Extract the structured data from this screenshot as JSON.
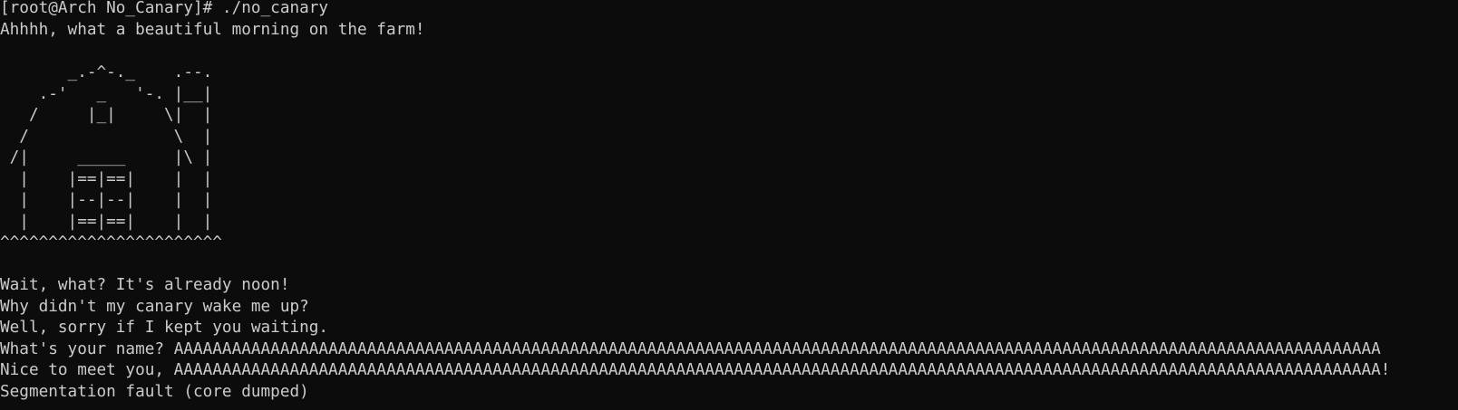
{
  "terminal": {
    "prompt": "[root@Arch No_Canary]# ",
    "command": "./no_canary",
    "greeting": "Ahhhh, what a beautiful morning on the farm!",
    "ascii_art": [
      "       _.-^-._    .--.",
      "    .-'   _   '-. |__|",
      "   /     |_|     \\|  |",
      "  /               \\  |",
      " /|     _____     |\\ |",
      "  |    |==|==|    |  |",
      "  |    |--|--|    |  |",
      "  |    |==|==|    |  |",
      "^^^^^^^^^^^^^^^^^^^^^^^"
    ],
    "messages": [
      "Wait, what? It's already noon!",
      "Why didn't my canary wake me up?",
      "Well, sorry if I kept you waiting."
    ],
    "name_prompt": "What's your name? ",
    "name_input": "AAAAAAAAAAAAAAAAAAAAAAAAAAAAAAAAAAAAAAAAAAAAAAAAAAAAAAAAAAAAAAAAAAAAAAAAAAAAAAAAAAAAAAAAAAAAAAAAAAAAAAAAAAAAAAAAAAAAAAAAAAAAA",
    "reply_line": "Nice to meet you, AAAAAAAAAAAAAAAAAAAAAAAAAAAAAAAAAAAAAAAAAAAAAAAAAAAAAAAAAAAAAAAAAAAAAAAAAAAAAAAAAAAAAAAAAAAAAAAAAAAAAAAAAAAAAAAAAAAAAAAAAAAAA!",
    "crash_message": "Segmentation fault (core dumped)",
    "colors": {
      "background": "#0c0c0c",
      "foreground": "#cccccc"
    }
  }
}
